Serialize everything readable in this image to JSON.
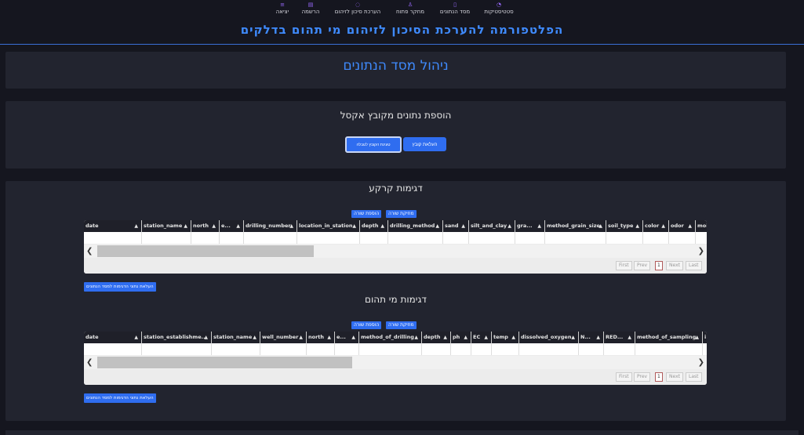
{
  "nav": {
    "items": [
      {
        "label": "סטטיסטיקות",
        "icon": "chart-icon"
      },
      {
        "label": "מסד הנתונים",
        "icon": "database-icon"
      },
      {
        "label": "מחקר פתוח",
        "icon": "research-icon"
      },
      {
        "label": "הערכת סיכון לזיהום",
        "icon": "risk-icon"
      },
      {
        "label": "הרשמה",
        "icon": "register-icon"
      },
      {
        "label": "יציאה",
        "icon": "logout-icon"
      }
    ],
    "brand": "הפלטפורמה להערכת הסיכון לזיהום מי תהום בדלקים"
  },
  "page": {
    "title": "ניהול מסד הנתונים"
  },
  "excel": {
    "title": "הוספת נתונים מקובץ אקסל",
    "upload_label": "העלאת קובץ",
    "load_table_label": "טעינת הקובץ לטבלה"
  },
  "soil": {
    "title": "דגימות קרקע",
    "add_row": "הוספת שורה",
    "delete_row": "מחיקת שורה",
    "upload": "העלאת נתוני הדגימות למסד הנתונים",
    "columns": [
      "date",
      "station_name",
      "north",
      "e...",
      "drilling_number",
      "location_in_station",
      "depth",
      "drilling_method",
      "sand",
      "silt_and_clay",
      "gra...",
      "method_grain_size",
      "soil_type",
      "color",
      "odor",
      "moi"
    ]
  },
  "water": {
    "title": "דגימות מי תהום",
    "add_row": "הוספת שורה",
    "delete_row": "מחיקת שורה",
    "upload": "העלאת נתוני הדגימות למסד הנתונים",
    "columns": [
      "date",
      "station_establishme...",
      "station_name",
      "well_number",
      "north",
      "e...",
      "method_of_drilling",
      "depth",
      "ph",
      "EC",
      "temp",
      "dissolved_oxygen",
      "N...",
      "RED...",
      "method_of_sampling",
      "i"
    ]
  },
  "pager": {
    "first": "First",
    "prev": "Prev",
    "page": "1",
    "next": "Next",
    "last": "Last"
  },
  "colors": {
    "accent": "#3f8bff",
    "button": "#2f6df0",
    "background": "#15161f",
    "card": "#22242f"
  }
}
